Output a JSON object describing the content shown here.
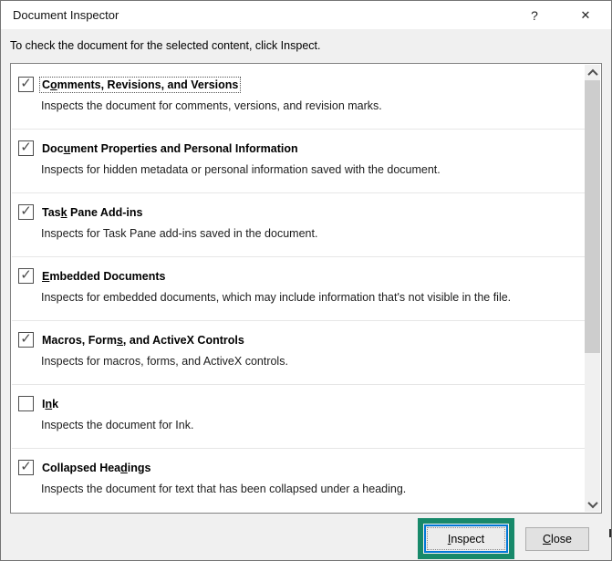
{
  "window": {
    "title": "Document Inspector",
    "help_icon": "?",
    "close_icon": "✕"
  },
  "instruction": "To check the document for the selected content, click Inspect.",
  "list": {
    "items": [
      {
        "pre": "C",
        "key": "o",
        "post": "mments, Revisions, and Versions",
        "check": "✓",
        "desc": "Inspects the document for comments, versions, and revision marks."
      },
      {
        "pre": "Doc",
        "key": "u",
        "post": "ment Properties and Personal Information",
        "check": "✓",
        "desc": "Inspects for hidden metadata or personal information saved with the document."
      },
      {
        "pre": "Tas",
        "key": "k",
        "post": " Pane Add-ins",
        "check": "✓",
        "desc": "Inspects for Task Pane add-ins saved in the document."
      },
      {
        "pre": "",
        "key": "E",
        "post": "mbedded Documents",
        "check": "✓",
        "desc": "Inspects for embedded documents, which may include information that's not visible in the file."
      },
      {
        "pre": "Macros, Form",
        "key": "s",
        "post": ", and ActiveX Controls",
        "check": "✓",
        "desc": "Inspects for macros, forms, and ActiveX controls."
      },
      {
        "pre": "I",
        "key": "n",
        "post": "k",
        "check": "",
        "desc": "Inspects the document for Ink."
      },
      {
        "pre": "Collapsed Hea",
        "key": "d",
        "post": "ings",
        "check": "✓",
        "desc": "Inspects the document for text that has been collapsed under a heading."
      }
    ]
  },
  "buttons": {
    "inspect": {
      "key": "I",
      "rest": "nspect"
    },
    "close": {
      "key": "C",
      "rest": "lose"
    }
  },
  "colors": {
    "annotation_green": "#17896A",
    "default_button_border": "#0078D7",
    "title_bar": "#FFFFFF",
    "dialog_bg": "#F0F0F0",
    "scrollbar_thumb": "#CDCDCD"
  }
}
